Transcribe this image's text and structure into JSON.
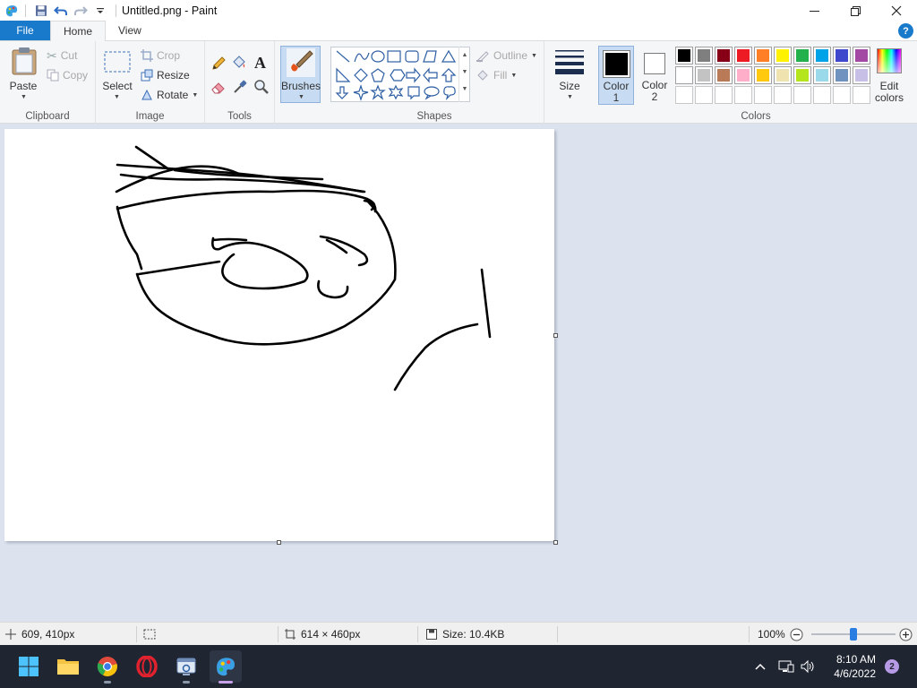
{
  "window": {
    "title": "Untitled.png - Paint"
  },
  "tabs": {
    "file": "File",
    "home": "Home",
    "view": "View",
    "help": "?"
  },
  "clipboard": {
    "paste": "Paste",
    "cut": "Cut",
    "copy": "Copy",
    "label": "Clipboard"
  },
  "image": {
    "select": "Select",
    "crop": "Crop",
    "resize": "Resize",
    "rotate": "Rotate",
    "label": "Image"
  },
  "tools": {
    "label": "Tools",
    "text_glyph": "A"
  },
  "brushes": {
    "label": "Brushes"
  },
  "shapes": {
    "outline": "Outline",
    "fill": "Fill",
    "label": "Shapes"
  },
  "size": {
    "label": "Size"
  },
  "colors": {
    "color1_line1": "Color",
    "color1_line2": "1",
    "color2_line1": "Color",
    "color2_line2": "2",
    "color1_value": "#000000",
    "color2_value": "#ffffff",
    "edit_line1": "Edit",
    "edit_line2": "colors",
    "label": "Colors",
    "palette_row1": [
      "#000000",
      "#7f7f7f",
      "#880015",
      "#ed1c24",
      "#ff7f27",
      "#fff200",
      "#22b14c",
      "#00a2e8",
      "#3f48cc",
      "#a349a4"
    ],
    "palette_row2": [
      "#ffffff",
      "#c3c3c3",
      "#b97a57",
      "#ffaec9",
      "#ffc90e",
      "#efe4b0",
      "#b5e61d",
      "#99d9ea",
      "#7092be",
      "#c8bfe7"
    ]
  },
  "status": {
    "cursor_pos": "609, 410px",
    "canvas_size": "614 × 460px",
    "file_size": "Size: 10.4KB",
    "zoom": "100%",
    "zoom_fraction": 0.5
  },
  "taskbar": {
    "time": "8:10 AM",
    "date": "4/6/2022",
    "notifications": "2"
  }
}
